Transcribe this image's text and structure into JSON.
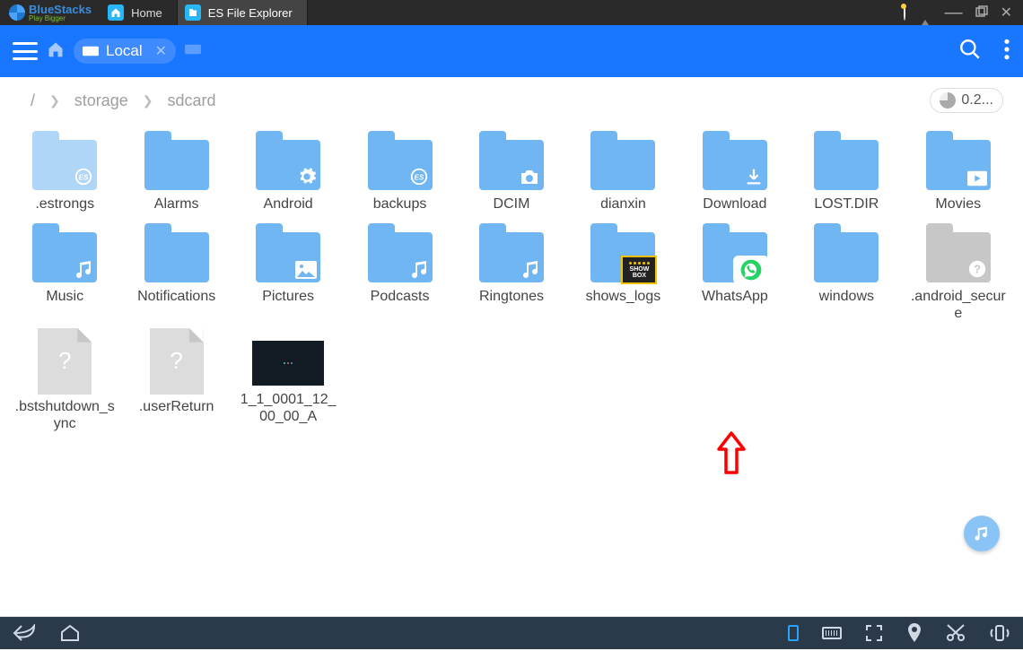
{
  "titlebar": {
    "brand_name": "BlueStacks",
    "brand_tag": "Play Bigger",
    "tabs": [
      {
        "label": "Home"
      },
      {
        "label": "ES File Explorer"
      }
    ]
  },
  "toolbar": {
    "chip_label": "Local"
  },
  "breadcrumb": {
    "root": "/",
    "parts": [
      "storage",
      "sdcard"
    ],
    "analyze_label": "0.2..."
  },
  "annotation": {
    "target_item": "WhatsApp"
  },
  "items": [
    {
      "name": ".estrongs",
      "kind": "folder",
      "variant": "faint",
      "badge": "es"
    },
    {
      "name": "Alarms",
      "kind": "folder"
    },
    {
      "name": "Android",
      "kind": "folder",
      "badge": "gear"
    },
    {
      "name": "backups",
      "kind": "folder",
      "badge": "es"
    },
    {
      "name": "DCIM",
      "kind": "folder",
      "badge": "camera"
    },
    {
      "name": "dianxin",
      "kind": "folder"
    },
    {
      "name": "Download",
      "kind": "folder",
      "badge": "download"
    },
    {
      "name": "LOST.DIR",
      "kind": "folder"
    },
    {
      "name": "Movies",
      "kind": "folder",
      "badge": "play"
    },
    {
      "name": "Music",
      "kind": "folder",
      "badge": "music"
    },
    {
      "name": "Notifications",
      "kind": "folder"
    },
    {
      "name": "Pictures",
      "kind": "folder",
      "badge": "image"
    },
    {
      "name": "Podcasts",
      "kind": "folder",
      "badge": "music"
    },
    {
      "name": "Ringtones",
      "kind": "folder",
      "badge": "music"
    },
    {
      "name": "shows_logs",
      "kind": "folder",
      "overlay": "showbox"
    },
    {
      "name": "WhatsApp",
      "kind": "folder",
      "overlay": "whatsapp"
    },
    {
      "name": "windows",
      "kind": "folder"
    },
    {
      "name": ".android_secure",
      "kind": "folder",
      "variant": "locked",
      "badge": "question"
    },
    {
      "name": ".bstshutdown_sync",
      "kind": "file",
      "variant": "unknown"
    },
    {
      "name": ".userReturn",
      "kind": "file",
      "variant": "unknown"
    },
    {
      "name": "1_1_0001_12_00_00_A",
      "kind": "file",
      "variant": "dark"
    }
  ],
  "overlay_text": {
    "showbox_line1": "SHOW",
    "showbox_line2": "BOX"
  }
}
